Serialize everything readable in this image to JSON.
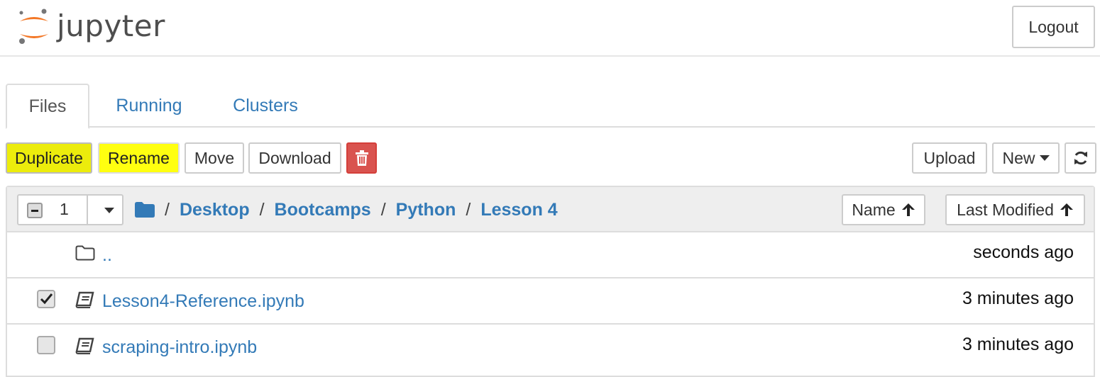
{
  "header": {
    "logo_text": "jupyter",
    "logout_label": "Logout"
  },
  "tabs": [
    {
      "label": "Files"
    },
    {
      "label": "Running"
    },
    {
      "label": "Clusters"
    }
  ],
  "toolbar": {
    "duplicate_label": "Duplicate",
    "rename_label": "Rename",
    "move_label": "Move",
    "download_label": "Download",
    "delete_icon": "trash-icon",
    "upload_label": "Upload",
    "new_label": "New",
    "refresh_icon": "refresh-icon"
  },
  "list_header": {
    "selected_count": "1",
    "breadcrumb": [
      "Desktop",
      "Bootcamps",
      "Python",
      "Lesson 4"
    ],
    "sort_name_label": "Name",
    "sort_modified_label": "Last Modified"
  },
  "files": [
    {
      "name": "..",
      "modified": "seconds ago",
      "type": "folder",
      "checked": false
    },
    {
      "name": "Lesson4-Reference.ipynb",
      "modified": "3 minutes ago",
      "type": "notebook",
      "checked": true
    },
    {
      "name": "scraping-intro.ipynb",
      "modified": "3 minutes ago",
      "type": "notebook",
      "checked": false
    }
  ],
  "colors": {
    "link": "#337ab7",
    "highlight": "#ffff00",
    "danger": "#d9534f",
    "logo_orange": "#f37726"
  }
}
